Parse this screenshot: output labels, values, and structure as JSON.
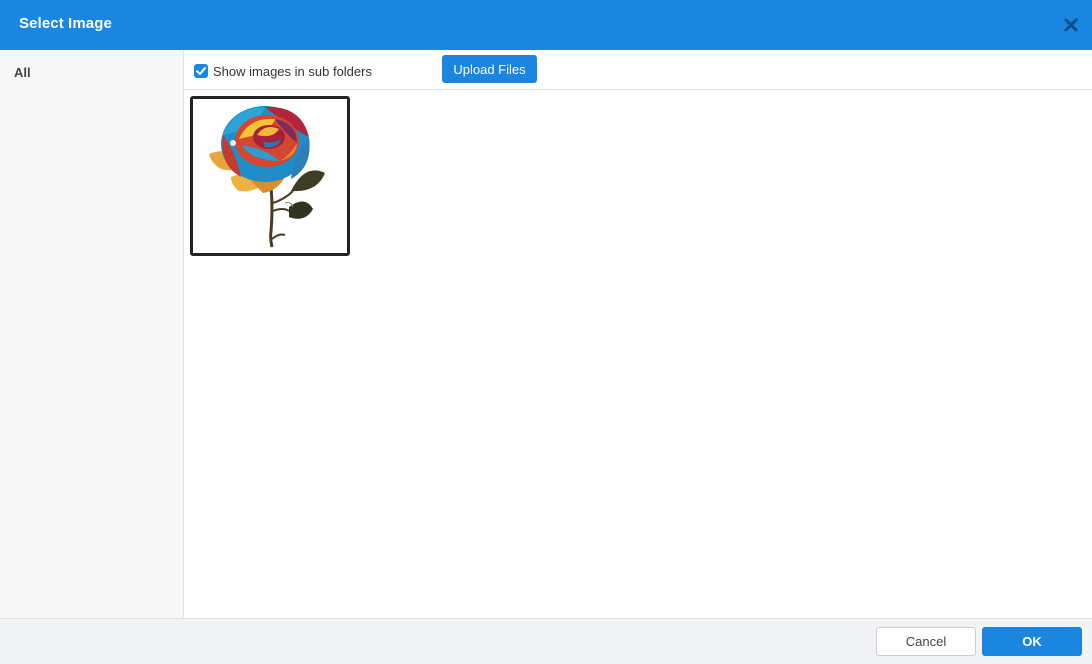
{
  "dialog": {
    "title": "Select Image"
  },
  "sidebar": {
    "items": [
      {
        "label": "All"
      }
    ]
  },
  "toolbar": {
    "show_subfolders_label": "Show images in sub folders",
    "show_subfolders_checked": true,
    "upload_label": "Upload Files"
  },
  "images": [
    {
      "description": "multicolored rose",
      "selected": true
    }
  ],
  "footer": {
    "cancel_label": "Cancel",
    "ok_label": "OK"
  },
  "colors": {
    "accent": "#1a86e0",
    "selection_border": "#222222"
  }
}
